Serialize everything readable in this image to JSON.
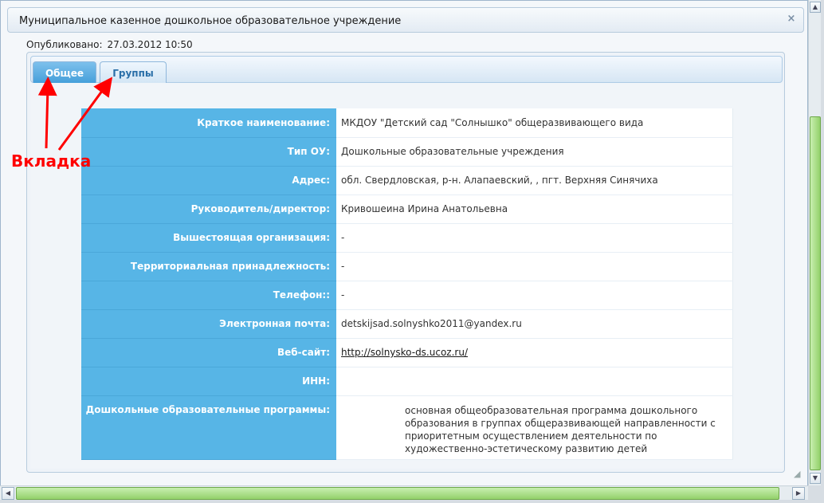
{
  "dialog": {
    "title": "Муниципальное казенное дошкольное образовательное учреждение",
    "close_icon": "×"
  },
  "published": {
    "label": "Опубликовано:",
    "value": "27.03.2012 10:50"
  },
  "tabs": [
    {
      "label": "Общее",
      "active": true
    },
    {
      "label": "Группы",
      "active": false
    }
  ],
  "fields": [
    {
      "label": "Краткое наименование:",
      "value": "МКДОУ \"Детский сад \"Солнышко\" общеразвивающего вида"
    },
    {
      "label": "Тип ОУ:",
      "value": "Дошкольные образовательные учреждения"
    },
    {
      "label": "Адрес:",
      "value": "обл. Свердловская, р-н. Алапаевский, , пгт. Верхняя Синячиха"
    },
    {
      "label": "Руководитель/директор:",
      "value": "Кривошеина Ирина Анатольевна"
    },
    {
      "label": "Вышестоящая организация:",
      "value": "-"
    },
    {
      "label": "Территориальная принадлежность:",
      "value": "-"
    },
    {
      "label": "Телефон::",
      "value": "-"
    },
    {
      "label": "Электронная почта:",
      "value": "detskijsad.solnyshko2011@yandex.ru"
    },
    {
      "label": "Веб-сайт:",
      "value": "http://solnysko-ds.ucoz.ru/"
    },
    {
      "label": "ИНН:",
      "value": ""
    },
    {
      "label": "Дошкольные образовательные программы:",
      "value": "основная общеобразовательная программа дошкольного образования в группах общеразвивающей направленности с приоритетным осуществлением деятельности по художественно-эстетическому развитию детей"
    }
  ],
  "annotation": {
    "label": "Вкладка",
    "color": "#ff0000"
  },
  "colors": {
    "label_cell": "#57b5e6",
    "active_tab": "#3f9cd8",
    "scroll_thumb": "#93d16b"
  }
}
